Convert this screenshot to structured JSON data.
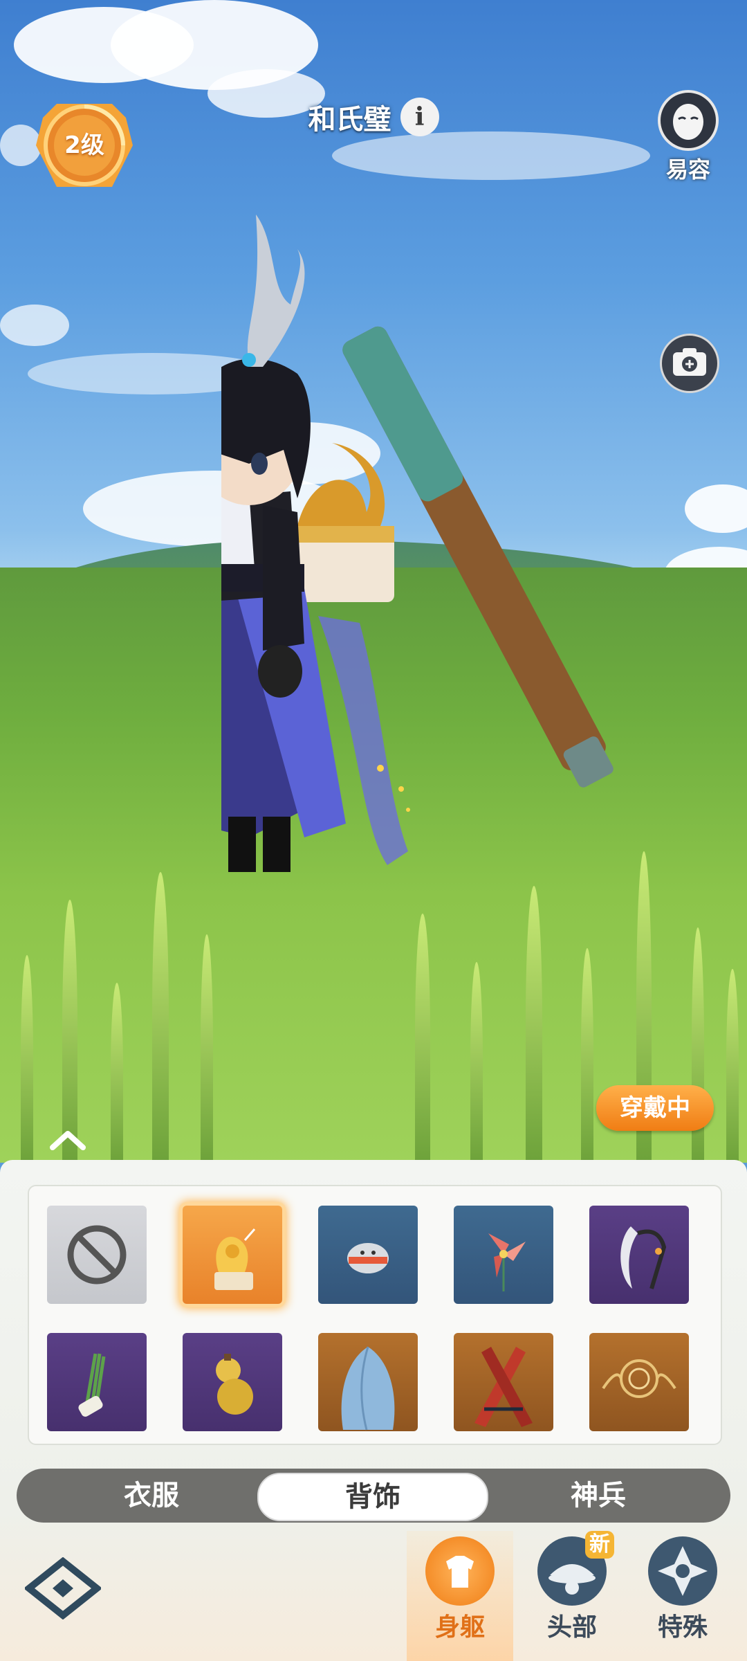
{
  "hud": {
    "level": "2级",
    "character_name": "和氏璧",
    "disguise_label": "易容",
    "wearing_label": "穿戴中"
  },
  "icons": {
    "level_badge": "level-badge-icon",
    "info": "info-icon",
    "disguise": "face-mask-icon",
    "camera": "camera-icon",
    "expand": "chevron-up-icon",
    "logo": "game-logo-icon"
  },
  "accessory_grid": {
    "items": [
      {
        "name": "none",
        "rarity": "none",
        "selected": false
      },
      {
        "name": "golden-dragon-box",
        "rarity": "gold",
        "selected": true
      },
      {
        "name": "seal-plush",
        "rarity": "blue",
        "selected": false
      },
      {
        "name": "flower-pinwheel",
        "rarity": "blue",
        "selected": false
      },
      {
        "name": "feather-staff",
        "rarity": "purple",
        "selected": false
      },
      {
        "name": "green-onion-bundle",
        "rarity": "purple",
        "selected": false
      },
      {
        "name": "gourd",
        "rarity": "purple",
        "selected": false
      },
      {
        "name": "blue-cape",
        "rarity": "orange",
        "selected": false
      },
      {
        "name": "crossed-blades",
        "rarity": "orange",
        "selected": false
      },
      {
        "name": "golden-halo-wings",
        "rarity": "orange",
        "selected": false
      }
    ]
  },
  "category_tabs": {
    "clothes": "衣服",
    "back": "背饰",
    "weapon": "神兵",
    "active": "back"
  },
  "bottom_nav": {
    "body": "身躯",
    "head": "头部",
    "special": "特殊",
    "new_badge": "新",
    "active": "body"
  },
  "colors": {
    "accent_orange": "#f07d14",
    "rarity_gold": "#e8822a",
    "rarity_blue": "#33557a",
    "rarity_purple": "#47306e",
    "rarity_orange": "#8f5520"
  }
}
